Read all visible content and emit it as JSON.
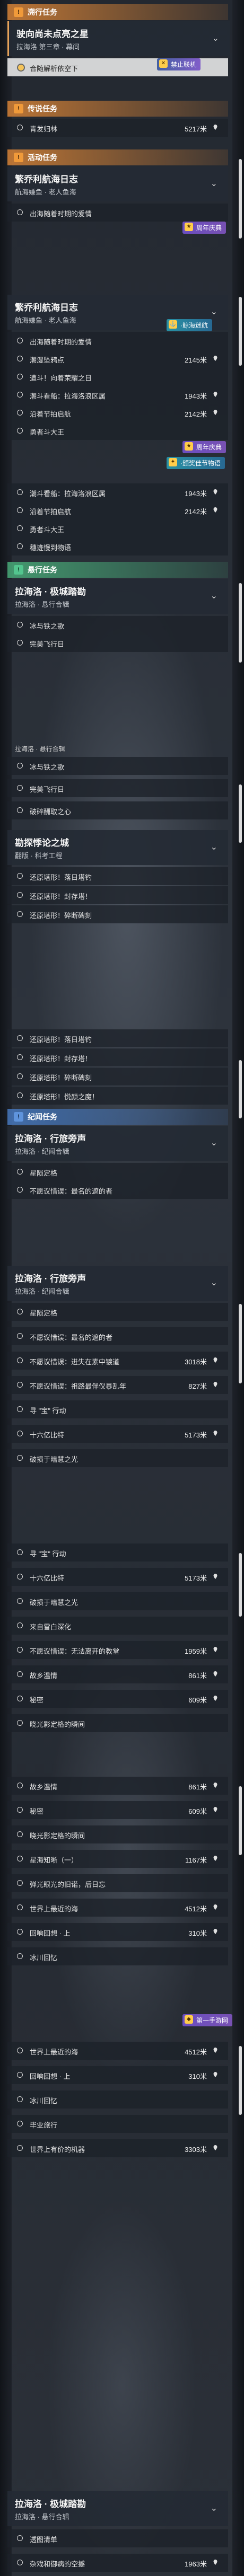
{
  "sections": {
    "tracking": "溯行任务",
    "legend": "传说任务",
    "event": "活动任务",
    "hunt": "悬行任务",
    "story": "纪闻任务"
  },
  "icons": {
    "section_badge": "exclamation-icon",
    "pin": "location-pin-icon",
    "chevron": "chevron-down-icon",
    "watermark": "mobile-game-logo-icon"
  },
  "colors": {
    "orange": "#f09a3a",
    "green": "#53c58e",
    "blue": "#5f94dc"
  },
  "c1": {
    "title": "驶向尚未点亮之星",
    "sub": "拉海洛 第三章 · 幕间",
    "sel": "合随解析依空下",
    "tag": "禁止联机"
  },
  "c2": {
    "row": "青发归林",
    "dist": "5217米"
  },
  "c3": {
    "title": "繁乔利航海日志",
    "sub": "航海嫌鱼 · 老人鱼海",
    "rows": [
      "出海随着时期的爱情"
    ],
    "tag": "周年庆典"
  },
  "c4": {
    "title": "繁乔利航海日志",
    "sub": "航海嫌鱼 · 老人鱼海",
    "tag1": "·鲸海迷航",
    "tag2": "周年庆典",
    "tag3": "·颁奖佳节物语",
    "rows": [
      {
        "t": "出海随着时期的爱情",
        "d": ""
      },
      {
        "t": "潮湿坠鸦点",
        "d": "2145米"
      },
      {
        "t": "遭斗！向着荣耀之日",
        "d": ""
      },
      {
        "t": "潮斗看船：拉海洛浪区属",
        "d": "1943米"
      },
      {
        "t": "沿着节拍启航",
        "d": "2142米"
      },
      {
        "t": "勇者斗大王",
        "d": ""
      }
    ]
  },
  "c5": {
    "rows": [
      {
        "t": "潮斗看船：拉海洛浪区属",
        "d": "1943米"
      },
      {
        "t": "沿着节拍启航",
        "d": "2142米"
      },
      {
        "t": "勇者斗大王",
        "d": ""
      },
      {
        "t": "穗迹慢到物语",
        "d": ""
      }
    ]
  },
  "c6": {
    "title": "拉海洛 · 极城踏勘",
    "sub": "拉海洛 · 悬行合辑",
    "rows": [
      "冰与铁之歌",
      "完美飞行日",
      "",
      "拉海洛 · 悬行合辑"
    ]
  },
  "c7": {
    "rows": [
      "冰与铁之歌",
      "完美飞行日",
      "破碎酬取之心"
    ]
  },
  "c8": {
    "title": "勘探悸论之城",
    "sub": "翻版 · 科考工程",
    "rows": [
      "还原塔形！落日塔钓",
      "还原塔形！封存塔！",
      "还原塔形！碎断碑刻"
    ]
  },
  "c9": {
    "rows": [
      "还原塔形！落日塔钓",
      "还原塔形！封存塔！",
      "还原塔形！碎断碑刻",
      "还原塔形！悦颜之魔！"
    ]
  },
  "c10": {
    "title": "拉海洛 · 行旅旁声",
    "sub": "拉海洛 · 纪闻合辑",
    "rows": [
      "星陨定格",
      "不愿议惜误：最名的遮的者"
    ]
  },
  "c11": {
    "title": "拉海洛 · 行旅旁声",
    "sub": "拉海洛 · 纪闻合辑",
    "rows": [
      {
        "t": "星陨定格",
        "d": ""
      },
      {
        "t": "不愿议惜误：最名的遮的者",
        "d": ""
      },
      {
        "t": "不愿议惜误：进失在素中镀道",
        "d": "3018米"
      },
      {
        "t": "不愿议惜误：祖路最伴仪暴乱年",
        "d": "827米"
      },
      {
        "t": "寻 \"宝\" 行动",
        "d": ""
      },
      {
        "t": "十六亿比特",
        "d": "5173米"
      },
      {
        "t": "破损于暗慧之光",
        "d": ""
      }
    ]
  },
  "c12": {
    "rows": [
      {
        "t": "寻 \"宝\" 行动",
        "d": ""
      },
      {
        "t": "十六亿比特",
        "d": "5173米"
      },
      {
        "t": "破损于暗慧之光",
        "d": ""
      },
      {
        "t": "来自雪白深化",
        "d": ""
      },
      {
        "t": "不愿议惜误：无法离开的教堂",
        "d": "1959米"
      },
      {
        "t": "故乡温情",
        "d": "861米"
      },
      {
        "t": "秘密",
        "d": "609米"
      },
      {
        "t": "晓光影定格的瞬间",
        "d": ""
      }
    ]
  },
  "c13": {
    "rows": [
      {
        "t": "故乡温情",
        "d": "861米"
      },
      {
        "t": "秘密",
        "d": "609米"
      },
      {
        "t": "晓光影定格的瞬间",
        "d": ""
      },
      {
        "t": "星海知晰（一）",
        "d": "1167米"
      },
      {
        "t": "弹光眼光的旧诺，后日忘",
        "d": ""
      },
      {
        "t": "世界上最近的海",
        "d": "4512米"
      },
      {
        "t": "回响回想 · 上",
        "d": "310米"
      },
      {
        "t": "冰川回忆",
        "d": ""
      }
    ]
  },
  "c14": {
    "rows": [
      {
        "t": "世界上最近的海",
        "d": "4512米"
      },
      {
        "t": "回响回想 · 上",
        "d": "310米"
      },
      {
        "t": "冰川回忆",
        "d": ""
      },
      {
        "t": "毕业旅行",
        "d": ""
      },
      {
        "t": "世界上有价的机器",
        "d": "3303米"
      }
    ],
    "watermark": "第一手游网"
  },
  "c15": {
    "title": "拉海洛 · 极城踏勘",
    "sub": "拉海洛 · 悬行合辑",
    "rows": [
      {
        "t": "透图清单",
        "d": ""
      },
      {
        "t": "杂戏和御病的空撼",
        "d": "1963米"
      }
    ]
  }
}
